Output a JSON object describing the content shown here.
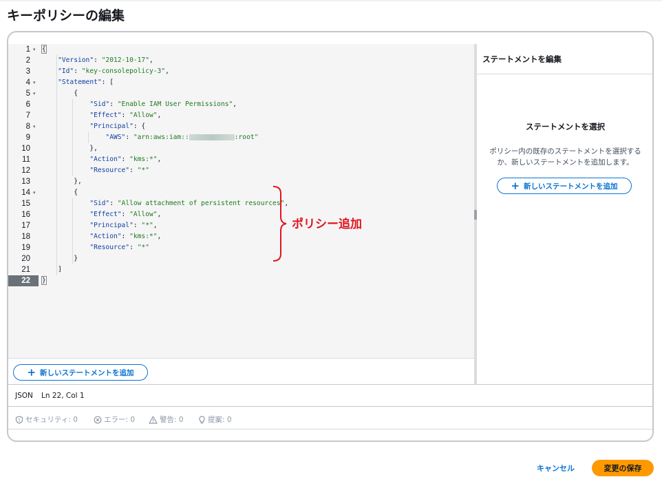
{
  "page": {
    "title": "キーポリシーの編集"
  },
  "editor": {
    "lines": [
      {
        "num": "1",
        "fold": true,
        "segs": [
          [
            "p",
            "{"
          ]
        ]
      },
      {
        "num": "2",
        "segs": [
          [
            "p",
            "    "
          ],
          [
            "k",
            "\"Version\""
          ],
          [
            "p",
            ": "
          ],
          [
            "s",
            "\"2012-10-17\""
          ],
          [
            "p",
            ","
          ]
        ]
      },
      {
        "num": "3",
        "segs": [
          [
            "p",
            "    "
          ],
          [
            "k",
            "\"Id\""
          ],
          [
            "p",
            ": "
          ],
          [
            "s",
            "\"key-consolepolicy-3\""
          ],
          [
            "p",
            ","
          ]
        ]
      },
      {
        "num": "4",
        "fold": true,
        "segs": [
          [
            "p",
            "    "
          ],
          [
            "k",
            "\"Statement\""
          ],
          [
            "p",
            ": ["
          ]
        ]
      },
      {
        "num": "5",
        "fold": true,
        "segs": [
          [
            "p",
            "        {"
          ]
        ]
      },
      {
        "num": "6",
        "segs": [
          [
            "p",
            "            "
          ],
          [
            "k",
            "\"Sid\""
          ],
          [
            "p",
            ": "
          ],
          [
            "s",
            "\"Enable IAM User Permissions\""
          ],
          [
            "p",
            ","
          ]
        ]
      },
      {
        "num": "7",
        "segs": [
          [
            "p",
            "            "
          ],
          [
            "k",
            "\"Effect\""
          ],
          [
            "p",
            ": "
          ],
          [
            "s",
            "\"Allow\""
          ],
          [
            "p",
            ","
          ]
        ]
      },
      {
        "num": "8",
        "fold": true,
        "segs": [
          [
            "p",
            "            "
          ],
          [
            "k",
            "\"Principal\""
          ],
          [
            "p",
            ": {"
          ]
        ]
      },
      {
        "num": "9",
        "segs": [
          [
            "p",
            "                "
          ],
          [
            "k",
            "\"AWS\""
          ],
          [
            "p",
            ": "
          ],
          [
            "s",
            "\"arn:aws:iam::"
          ],
          [
            "b",
            ""
          ],
          [
            "s",
            ":root\""
          ]
        ]
      },
      {
        "num": "10",
        "segs": [
          [
            "p",
            "            },"
          ]
        ]
      },
      {
        "num": "11",
        "segs": [
          [
            "p",
            "            "
          ],
          [
            "k",
            "\"Action\""
          ],
          [
            "p",
            ": "
          ],
          [
            "s",
            "\"kms:*\""
          ],
          [
            "p",
            ","
          ]
        ]
      },
      {
        "num": "12",
        "segs": [
          [
            "p",
            "            "
          ],
          [
            "k",
            "\"Resource\""
          ],
          [
            "p",
            ": "
          ],
          [
            "s",
            "\"*\""
          ]
        ]
      },
      {
        "num": "13",
        "segs": [
          [
            "p",
            "        },"
          ]
        ]
      },
      {
        "num": "14",
        "fold": true,
        "segs": [
          [
            "p",
            "        {"
          ]
        ]
      },
      {
        "num": "15",
        "segs": [
          [
            "p",
            "            "
          ],
          [
            "k",
            "\"Sid\""
          ],
          [
            "p",
            ": "
          ],
          [
            "s",
            "\"Allow attachment of persistent resources\""
          ],
          [
            "p",
            ","
          ]
        ]
      },
      {
        "num": "16",
        "segs": [
          [
            "p",
            "            "
          ],
          [
            "k",
            "\"Effect\""
          ],
          [
            "p",
            ": "
          ],
          [
            "s",
            "\"Allow\""
          ],
          [
            "p",
            ","
          ]
        ]
      },
      {
        "num": "17",
        "segs": [
          [
            "p",
            "            "
          ],
          [
            "k",
            "\"Principal\""
          ],
          [
            "p",
            ": "
          ],
          [
            "s",
            "\"*\""
          ],
          [
            "p",
            ","
          ]
        ]
      },
      {
        "num": "18",
        "segs": [
          [
            "p",
            "            "
          ],
          [
            "k",
            "\"Action\""
          ],
          [
            "p",
            ": "
          ],
          [
            "s",
            "\"kms:*\""
          ],
          [
            "p",
            ","
          ]
        ]
      },
      {
        "num": "19",
        "segs": [
          [
            "p",
            "            "
          ],
          [
            "k",
            "\"Resource\""
          ],
          [
            "p",
            ": "
          ],
          [
            "s",
            "\"*\""
          ]
        ]
      },
      {
        "num": "20",
        "segs": [
          [
            "p",
            "        }"
          ]
        ]
      },
      {
        "num": "21",
        "segs": [
          [
            "p",
            "    ]"
          ]
        ]
      },
      {
        "num": "22",
        "active": true,
        "segs": [
          [
            "p",
            "}"
          ]
        ]
      }
    ],
    "add_statement_label": "新しいステートメントを追加"
  },
  "annotation": {
    "text": "ポリシー追加",
    "color": "#e0141e"
  },
  "right_panel": {
    "title": "ステートメントを編集",
    "heading": "ステートメントを選択",
    "description": "ポリシー内の既存のステートメントを選択するか、新しいステートメントを追加します。",
    "add_statement_label": "新しいステートメントを追加"
  },
  "status": {
    "language": "JSON",
    "position": "Ln 22, Col 1",
    "security": "セキュリティ: 0",
    "errors": "エラー: 0",
    "warnings": "警告: 0",
    "suggestions": "提案: 0"
  },
  "footer": {
    "cancel_label": "キャンセル",
    "save_label": "変更の保存"
  },
  "colors": {
    "accent": "#0972d3",
    "primary_button": "#ff9900",
    "json_key": "#0f3f9f",
    "json_string": "#1d7a1d"
  }
}
